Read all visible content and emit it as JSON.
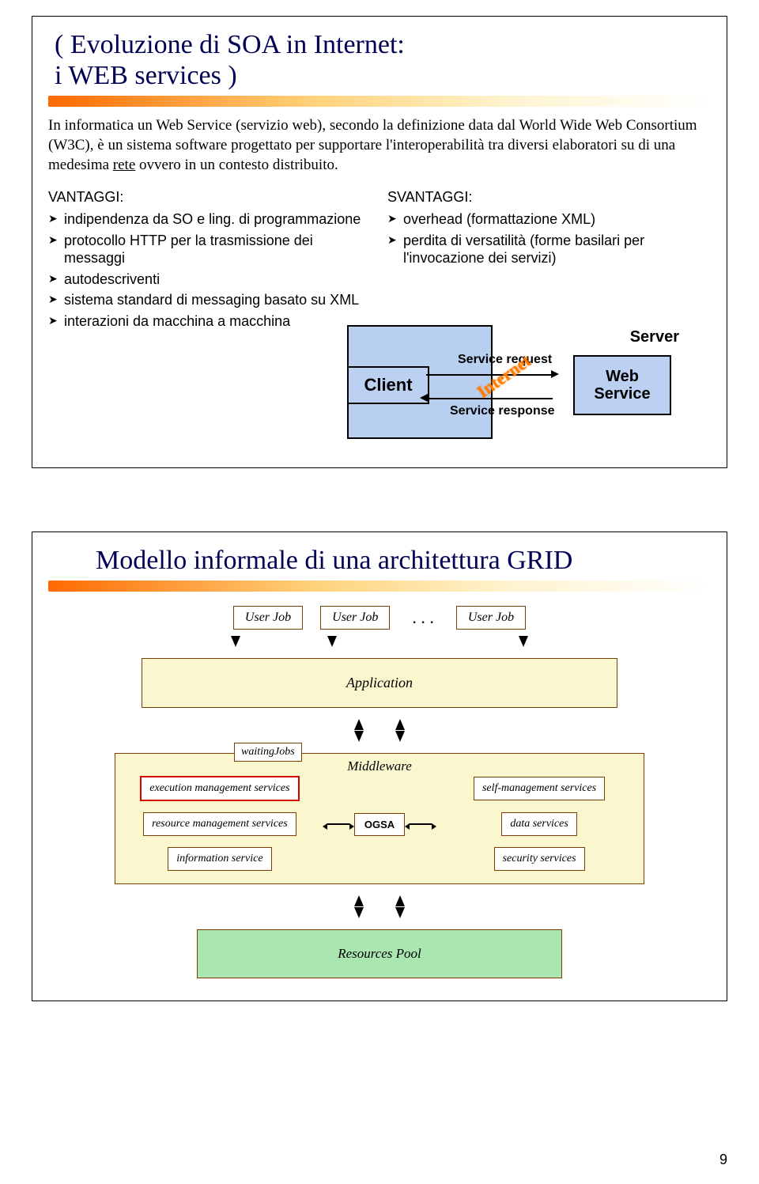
{
  "page_number": "9",
  "slide1": {
    "title": "( Evoluzione di SOA in Internet:\n        i WEB services )",
    "intro_a": "In informatica un Web Service (servizio web), secondo la definizione data dal World Wide Web Consortium (W3C), è un sistema software progettato per supportare l'interoperabilità tra diversi elaboratori su di una medesima ",
    "intro_u": "rete",
    "intro_b": " ovvero in un contesto distribuito.",
    "vantaggi_label": "VANTAGGI:",
    "vantaggi": [
      "indipendenza da SO e ling. di programmazione",
      "protocollo HTTP per la trasmissione dei messaggi",
      "autodescriventi",
      "sistema standard di messaging basato su XML",
      "interazioni da macchina a macchina"
    ],
    "svantaggi_label": "SVANTAGGI:",
    "svantaggi": [
      "overhead (formattazione XML)",
      "perdita di versatilità (forme basilari per l'invocazione dei servizi)"
    ],
    "diag": {
      "client": "Client",
      "server": "Server",
      "web_service": "Web\nService",
      "req": "Service request",
      "resp": "Service response",
      "internet": "Internet"
    }
  },
  "slide2": {
    "title": "Modello informale di una architettura GRID",
    "user_job": "User Job",
    "dots": ". . .",
    "application": "Application",
    "waiting": "waitingJobs",
    "middleware": "Middleware",
    "svc_exec": "execution management services",
    "svc_self": "self-management services",
    "svc_res": "resource management services",
    "svc_data": "data services",
    "svc_info": "information service",
    "svc_sec": "security services",
    "ogsa": "OGSA",
    "resources": "Resources Pool"
  }
}
